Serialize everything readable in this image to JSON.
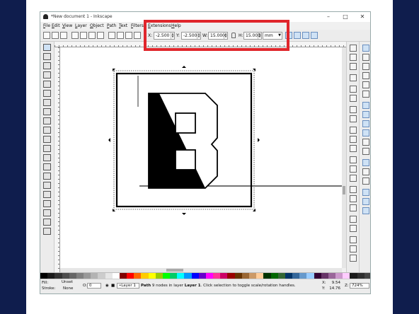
{
  "window": {
    "title": "*New document 1 - Inkscape",
    "controls": {
      "minimize": "–",
      "maximize": "□",
      "close": "✕"
    }
  },
  "menubar": {
    "items": [
      "File",
      "Edit",
      "View",
      "Layer",
      "Object",
      "Path",
      "Text",
      "Filters",
      "Extensions",
      "Help"
    ]
  },
  "toolbar": {
    "x_label": "X:",
    "x_value": "-2.500",
    "y_label": "Y:",
    "y_value": "-2.500",
    "w_label": "W:",
    "w_value": "15.000",
    "h_label": "H:",
    "h_value": "15.000",
    "unit": "mm",
    "lock_icon": "lock-icon"
  },
  "statusbar": {
    "fill_label": "Fill:",
    "fill_value": "Unset",
    "stroke_label": "Stroke:",
    "stroke_value": "None",
    "opacity_label": "O:",
    "opacity_value": "0",
    "layer_value": "•Layer 1",
    "message_bold": "Path",
    "message_rest": " 9 nodes in layer ",
    "message_layer": "Layer 1",
    "message_tail": ". Click selection to toggle scale/rotation handles.",
    "x_label": "X:",
    "x_value": "9.54",
    "y_label": "Y:",
    "y_value": "14.76",
    "z_label": "Z:",
    "zoom_value": "724%"
  },
  "palette_colors": [
    "#000000",
    "#1a1a1a",
    "#333333",
    "#4d4d4d",
    "#666666",
    "#808080",
    "#999999",
    "#b3b3b3",
    "#cccccc",
    "#e6e6e6",
    "#ffffff",
    "#800000",
    "#ff0000",
    "#ff6600",
    "#ffcc00",
    "#ffff00",
    "#99cc00",
    "#00ff00",
    "#00cc66",
    "#00ffff",
    "#0099ff",
    "#0000ff",
    "#6600cc",
    "#ff00ff",
    "#ff3399",
    "#cc0066",
    "#990000",
    "#663300",
    "#996633",
    "#cc9966",
    "#ffcc99",
    "#003300",
    "#006600",
    "#336633",
    "#003366",
    "#336699",
    "#6699cc",
    "#99ccff",
    "#330033",
    "#663366",
    "#996699",
    "#cc99cc",
    "#ffccff",
    "#1a1a1a",
    "#2e2e2e",
    "#444444"
  ],
  "colors": {
    "highlight": "#e0262c",
    "background": "#0f1d4d"
  }
}
